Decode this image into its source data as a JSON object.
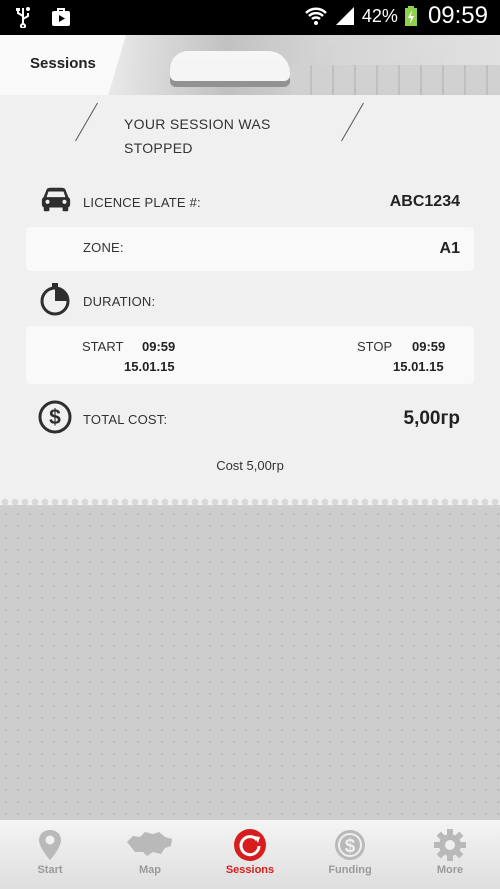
{
  "statusbar": {
    "battery": "42%",
    "time": "09:59"
  },
  "header": {
    "title": "Sessions"
  },
  "session": {
    "status_line1": "YOUR SESSION WAS",
    "status_line2": "STOPPED",
    "licence_label": "LICENCE PLATE #:",
    "licence_value": "ABC1234",
    "zone_label": "ZONE:",
    "zone_value": "A1",
    "duration_label": "DURATION:",
    "start_label": "START",
    "start_time": "09:59",
    "start_date": "15.01.15",
    "stop_label": "STOP",
    "stop_time": "09:59",
    "stop_date": "15.01.15",
    "total_label": "TOTAL COST:",
    "total_value": "5,00гр",
    "cost_line": "Cost 5,00гр"
  },
  "nav": {
    "items": [
      {
        "label": "Start",
        "icon": "map-pin-icon"
      },
      {
        "label": "Map",
        "icon": "ukraine-map-icon"
      },
      {
        "label": "Sessions",
        "icon": "sessions-refresh-icon"
      },
      {
        "label": "Funding",
        "icon": "dollar-icon"
      },
      {
        "label": "More",
        "icon": "gear-icon"
      }
    ],
    "active": "Sessions"
  },
  "colors": {
    "accent": "#d81d1d",
    "inactive": "#9a9a9a"
  }
}
